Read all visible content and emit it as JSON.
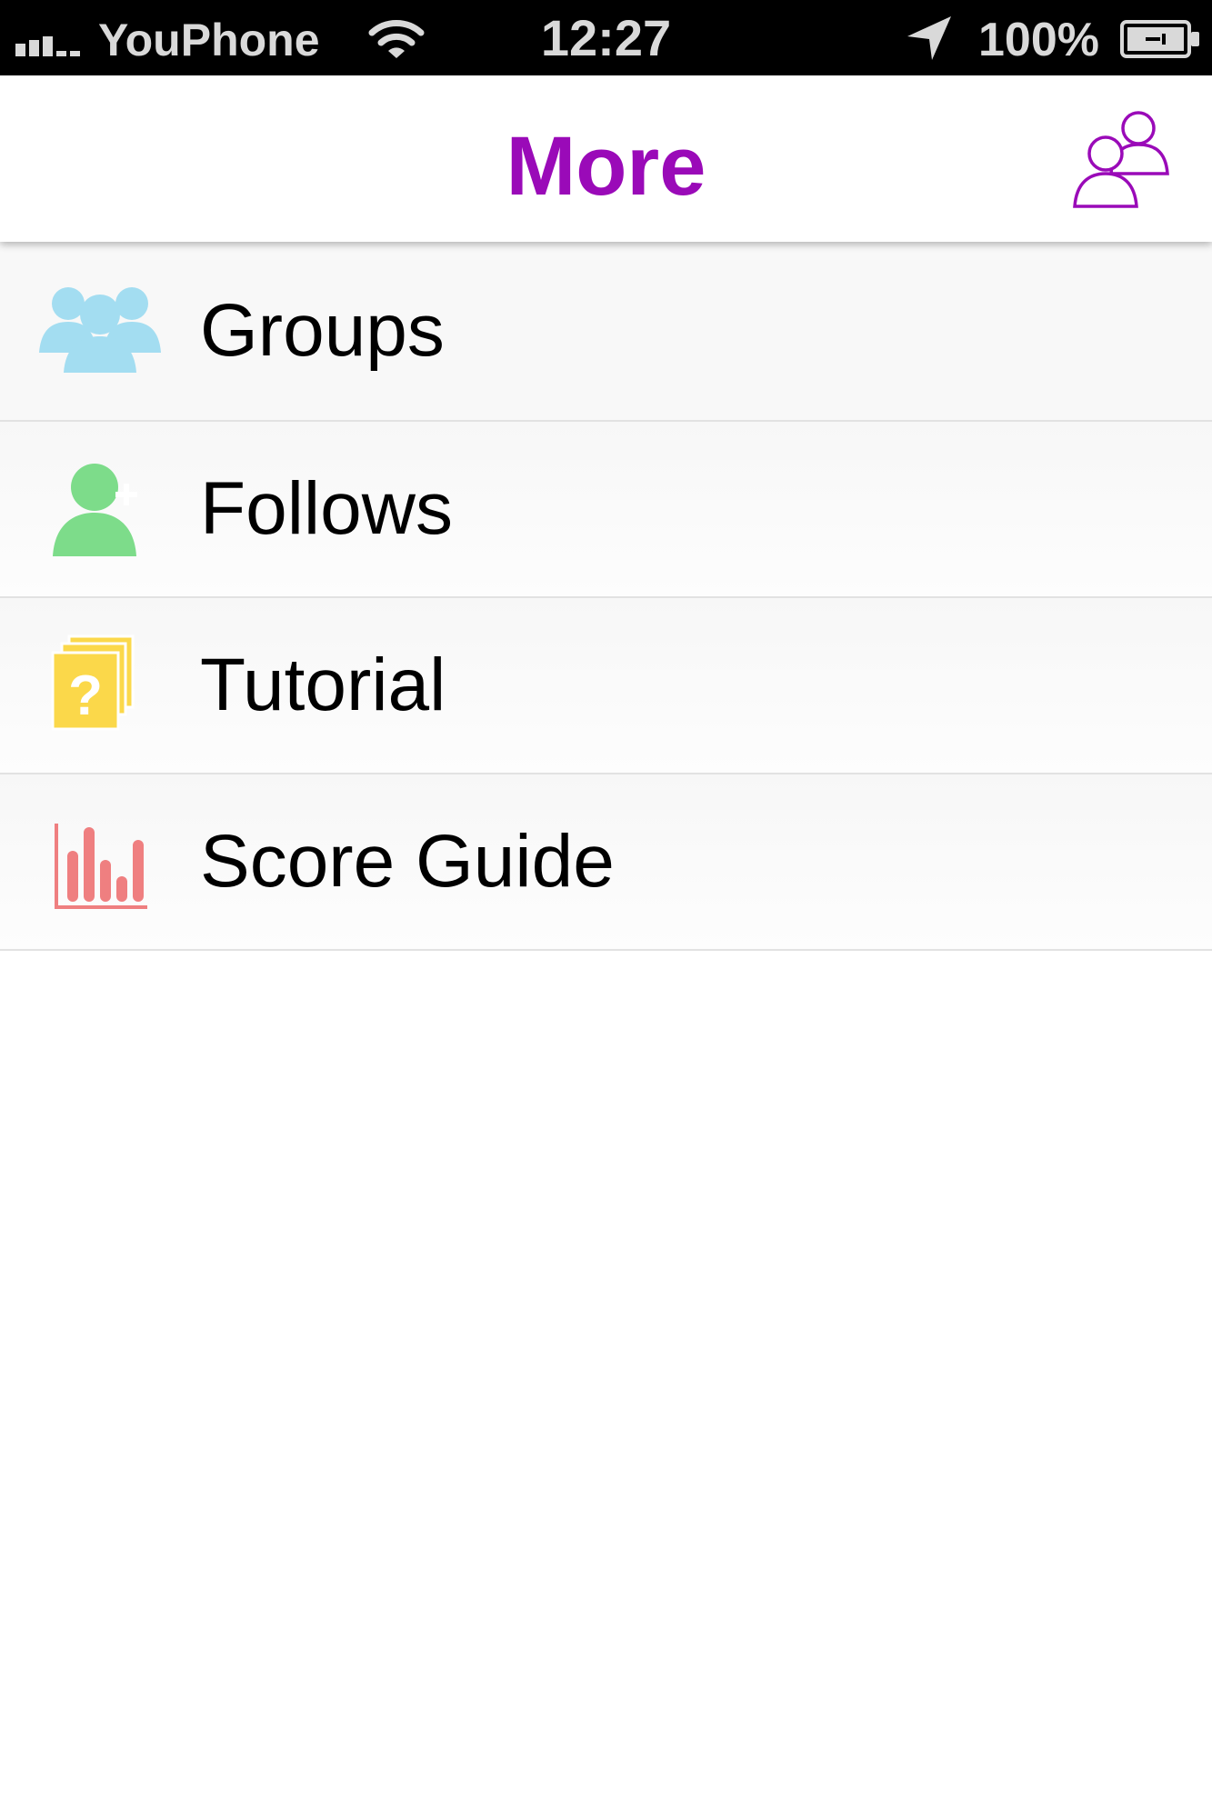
{
  "status_bar": {
    "carrier": "YouPhone",
    "time": "12:27",
    "battery": "100%"
  },
  "nav": {
    "title": "More",
    "right_icon": "friends-icon"
  },
  "menu": [
    {
      "label": "Groups",
      "icon": "groups-icon",
      "color": "#a3ddf1"
    },
    {
      "label": "Follows",
      "icon": "add-person-icon",
      "color": "#7ddc8a"
    },
    {
      "label": "Tutorial",
      "icon": "help-cards-icon",
      "color": "#fbd84a"
    },
    {
      "label": "Score Guide",
      "icon": "bar-chart-icon",
      "color": "#ef7f80"
    }
  ],
  "colors": {
    "accent": "#9a0ab8",
    "status_bar_bg": "#000000",
    "status_text": "#d9d9d9"
  }
}
